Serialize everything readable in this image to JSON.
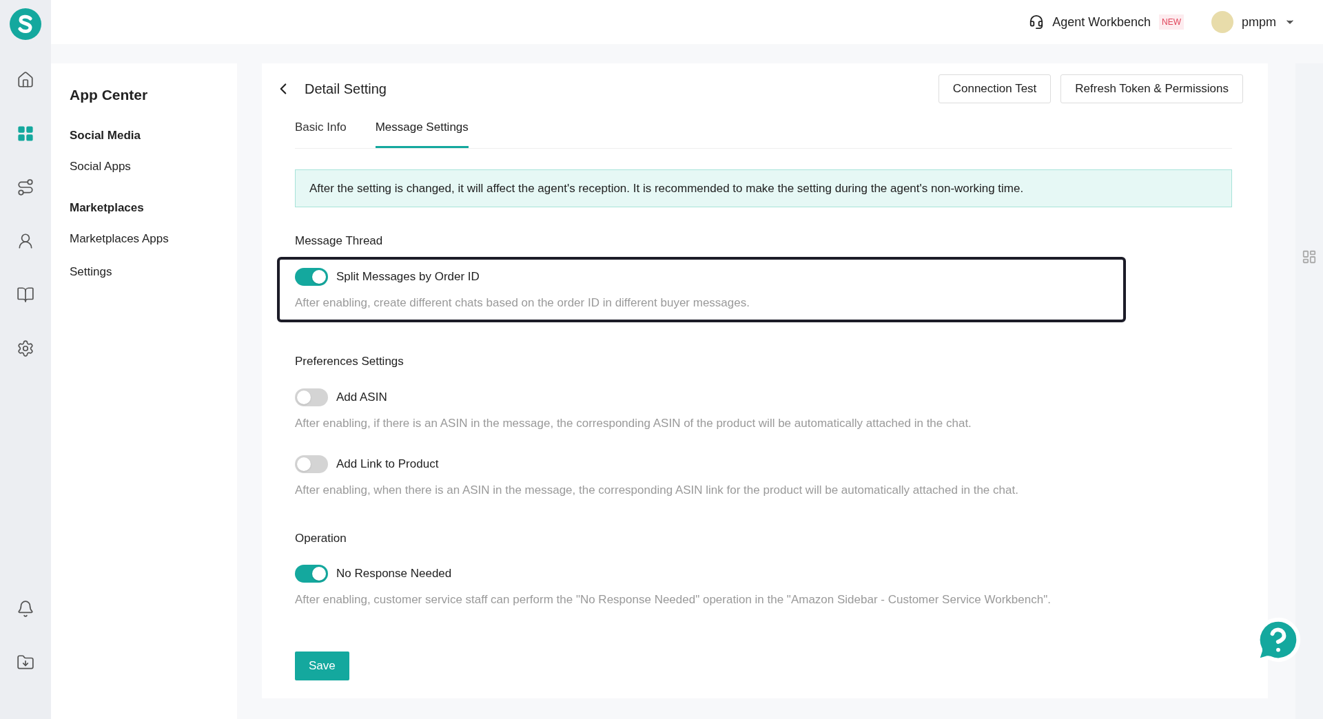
{
  "rail": {
    "items": [
      {
        "kind": "home",
        "selected": false
      },
      {
        "kind": "apps",
        "selected": true
      },
      {
        "kind": "route",
        "selected": false
      },
      {
        "kind": "agent",
        "selected": false
      },
      {
        "kind": "book",
        "selected": false
      },
      {
        "kind": "settings",
        "selected": false
      }
    ],
    "bottom": [
      {
        "kind": "bell",
        "selected": false
      },
      {
        "kind": "download",
        "selected": false
      }
    ]
  },
  "header": {
    "workbench": "Agent Workbench",
    "badge": "NEW",
    "user": "pmpm"
  },
  "sidebar": {
    "title": "App Center",
    "groups": [
      {
        "title": "Social Media",
        "items": [
          {
            "label": "Social Apps",
            "selected": false
          }
        ]
      },
      {
        "title": "Marketplaces",
        "items": [
          {
            "label": "Marketplaces Apps",
            "selected": false
          },
          {
            "label": "Settings",
            "selected": false
          }
        ]
      }
    ]
  },
  "page": {
    "title": "Detail Setting",
    "buttons": [
      "Connection Test",
      "Refresh Token & Permissions"
    ],
    "tabs": [
      {
        "label": "Basic Info",
        "selected": false
      },
      {
        "label": "Message Settings",
        "selected": true
      }
    ],
    "notice": "After the setting is changed, it will affect the agent's reception. It is recommended to make the setting during the agent's non-working time.",
    "sections": [
      {
        "title": "Message Thread",
        "highlighted": true,
        "settings": [
          {
            "label": "Split Messages by Order ID",
            "on": true,
            "description": "After enabling, create different chats based on the order ID in different buyer messages."
          }
        ]
      },
      {
        "title": "Preferences Settings",
        "highlighted": false,
        "settings": [
          {
            "label": "Add ASIN",
            "on": false,
            "description": "After enabling, if there is an ASIN in the message, the corresponding ASIN of the product will be automatically attached in the chat."
          },
          {
            "label": "Add Link to Product",
            "on": false,
            "description": "After enabling, when there is an ASIN in the message, the corresponding ASIN link for the product will be automatically attached in the chat."
          }
        ]
      },
      {
        "title": "Operation",
        "highlighted": false,
        "settings": [
          {
            "label": "No Response Needed",
            "on": true,
            "description": "After enabling, customer service staff can perform the \"No Response Needed\" operation in the \"Amazon Sidebar - Customer Service Workbench\"."
          }
        ]
      }
    ],
    "save": "Save"
  }
}
